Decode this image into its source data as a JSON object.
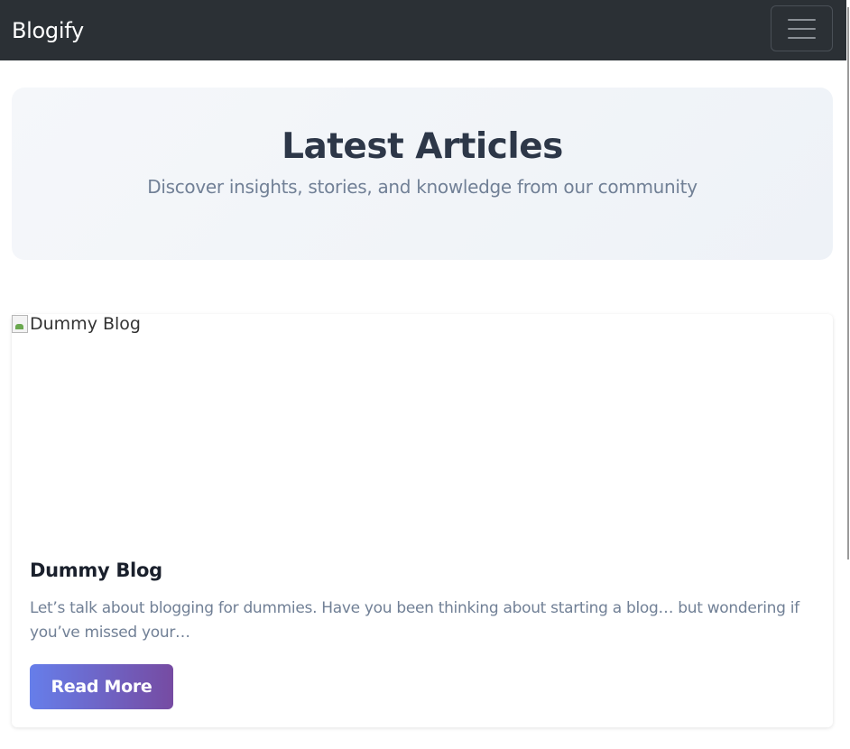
{
  "navbar": {
    "brand": "Blogify",
    "toggler_icon": "hamburger-menu-icon"
  },
  "hero": {
    "title": "Latest Articles",
    "subtitle": "Discover insights, stories, and knowledge from our community"
  },
  "posts": [
    {
      "image_alt": "Dummy Blog",
      "image_icon": "broken-image-icon",
      "title": "Dummy Blog",
      "excerpt": "Let’s talk about blogging for dummies. Have you been thinking about starting a blog… but wondering if you’ve missed your…",
      "button_label": "Read More"
    }
  ],
  "colors": {
    "navbar_bg": "#2b3035",
    "hero_title": "#2d3748",
    "muted_text": "#718096",
    "button_gradient_start": "#667eea",
    "button_gradient_end": "#764ba2"
  }
}
